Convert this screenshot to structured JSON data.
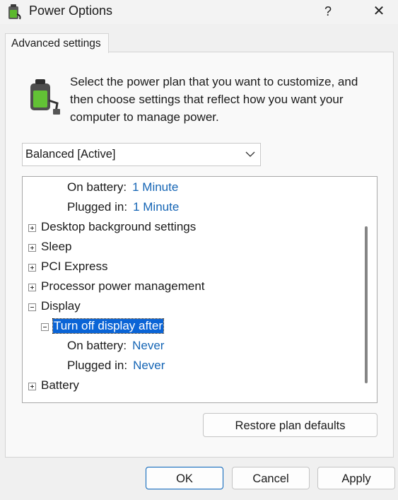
{
  "window": {
    "title": "Power Options",
    "help_label": "?",
    "close_label": "✕"
  },
  "tabs": [
    {
      "label": "Advanced settings"
    }
  ],
  "description": "Select the power plan that you want to customize, and then choose settings that reflect how you want your computer to manage power.",
  "plan_select": {
    "value": "Balanced [Active]"
  },
  "tree": {
    "top_on_battery": {
      "label": "On battery:",
      "value": "1 Minute"
    },
    "top_plugged_in": {
      "label": "Plugged in:",
      "value": "1 Minute"
    },
    "desktop_background": "Desktop background settings",
    "sleep": "Sleep",
    "pci_express": "PCI Express",
    "processor": "Processor power management",
    "display": "Display",
    "turn_off_display": "Turn off display after",
    "display_on_battery": {
      "label": "On battery:",
      "value": "Never"
    },
    "display_plugged_in": {
      "label": "Plugged in:",
      "value": "Never"
    },
    "battery": "Battery"
  },
  "buttons": {
    "restore": "Restore plan defaults",
    "ok": "OK",
    "cancel": "Cancel",
    "apply": "Apply"
  },
  "colors": {
    "accent": "#0a64d6",
    "link_value": "#1565b5"
  }
}
